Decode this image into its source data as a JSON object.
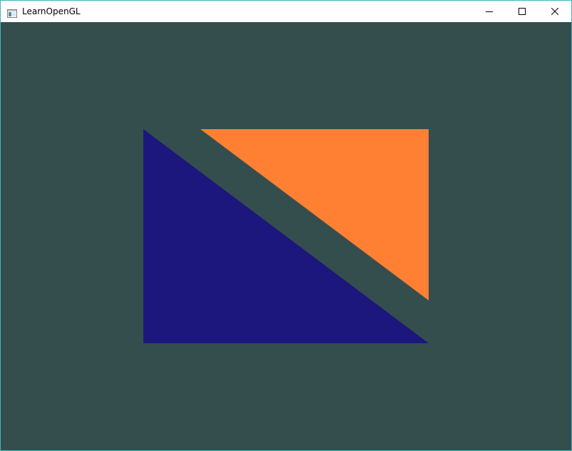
{
  "window": {
    "title": "LearnOpenGL",
    "icon": "app-window-icon",
    "controls": [
      {
        "name": "minimize-button",
        "icon": "minimize-icon"
      },
      {
        "name": "maximize-button",
        "icon": "maximize-icon"
      },
      {
        "name": "close-button",
        "icon": "close-icon"
      }
    ]
  },
  "scene": {
    "clear_color": "#344e4e",
    "triangles": [
      {
        "name": "blue-triangle",
        "color": "#1b177d"
      },
      {
        "name": "orange-triangle",
        "color": "#ff7f33"
      }
    ]
  }
}
